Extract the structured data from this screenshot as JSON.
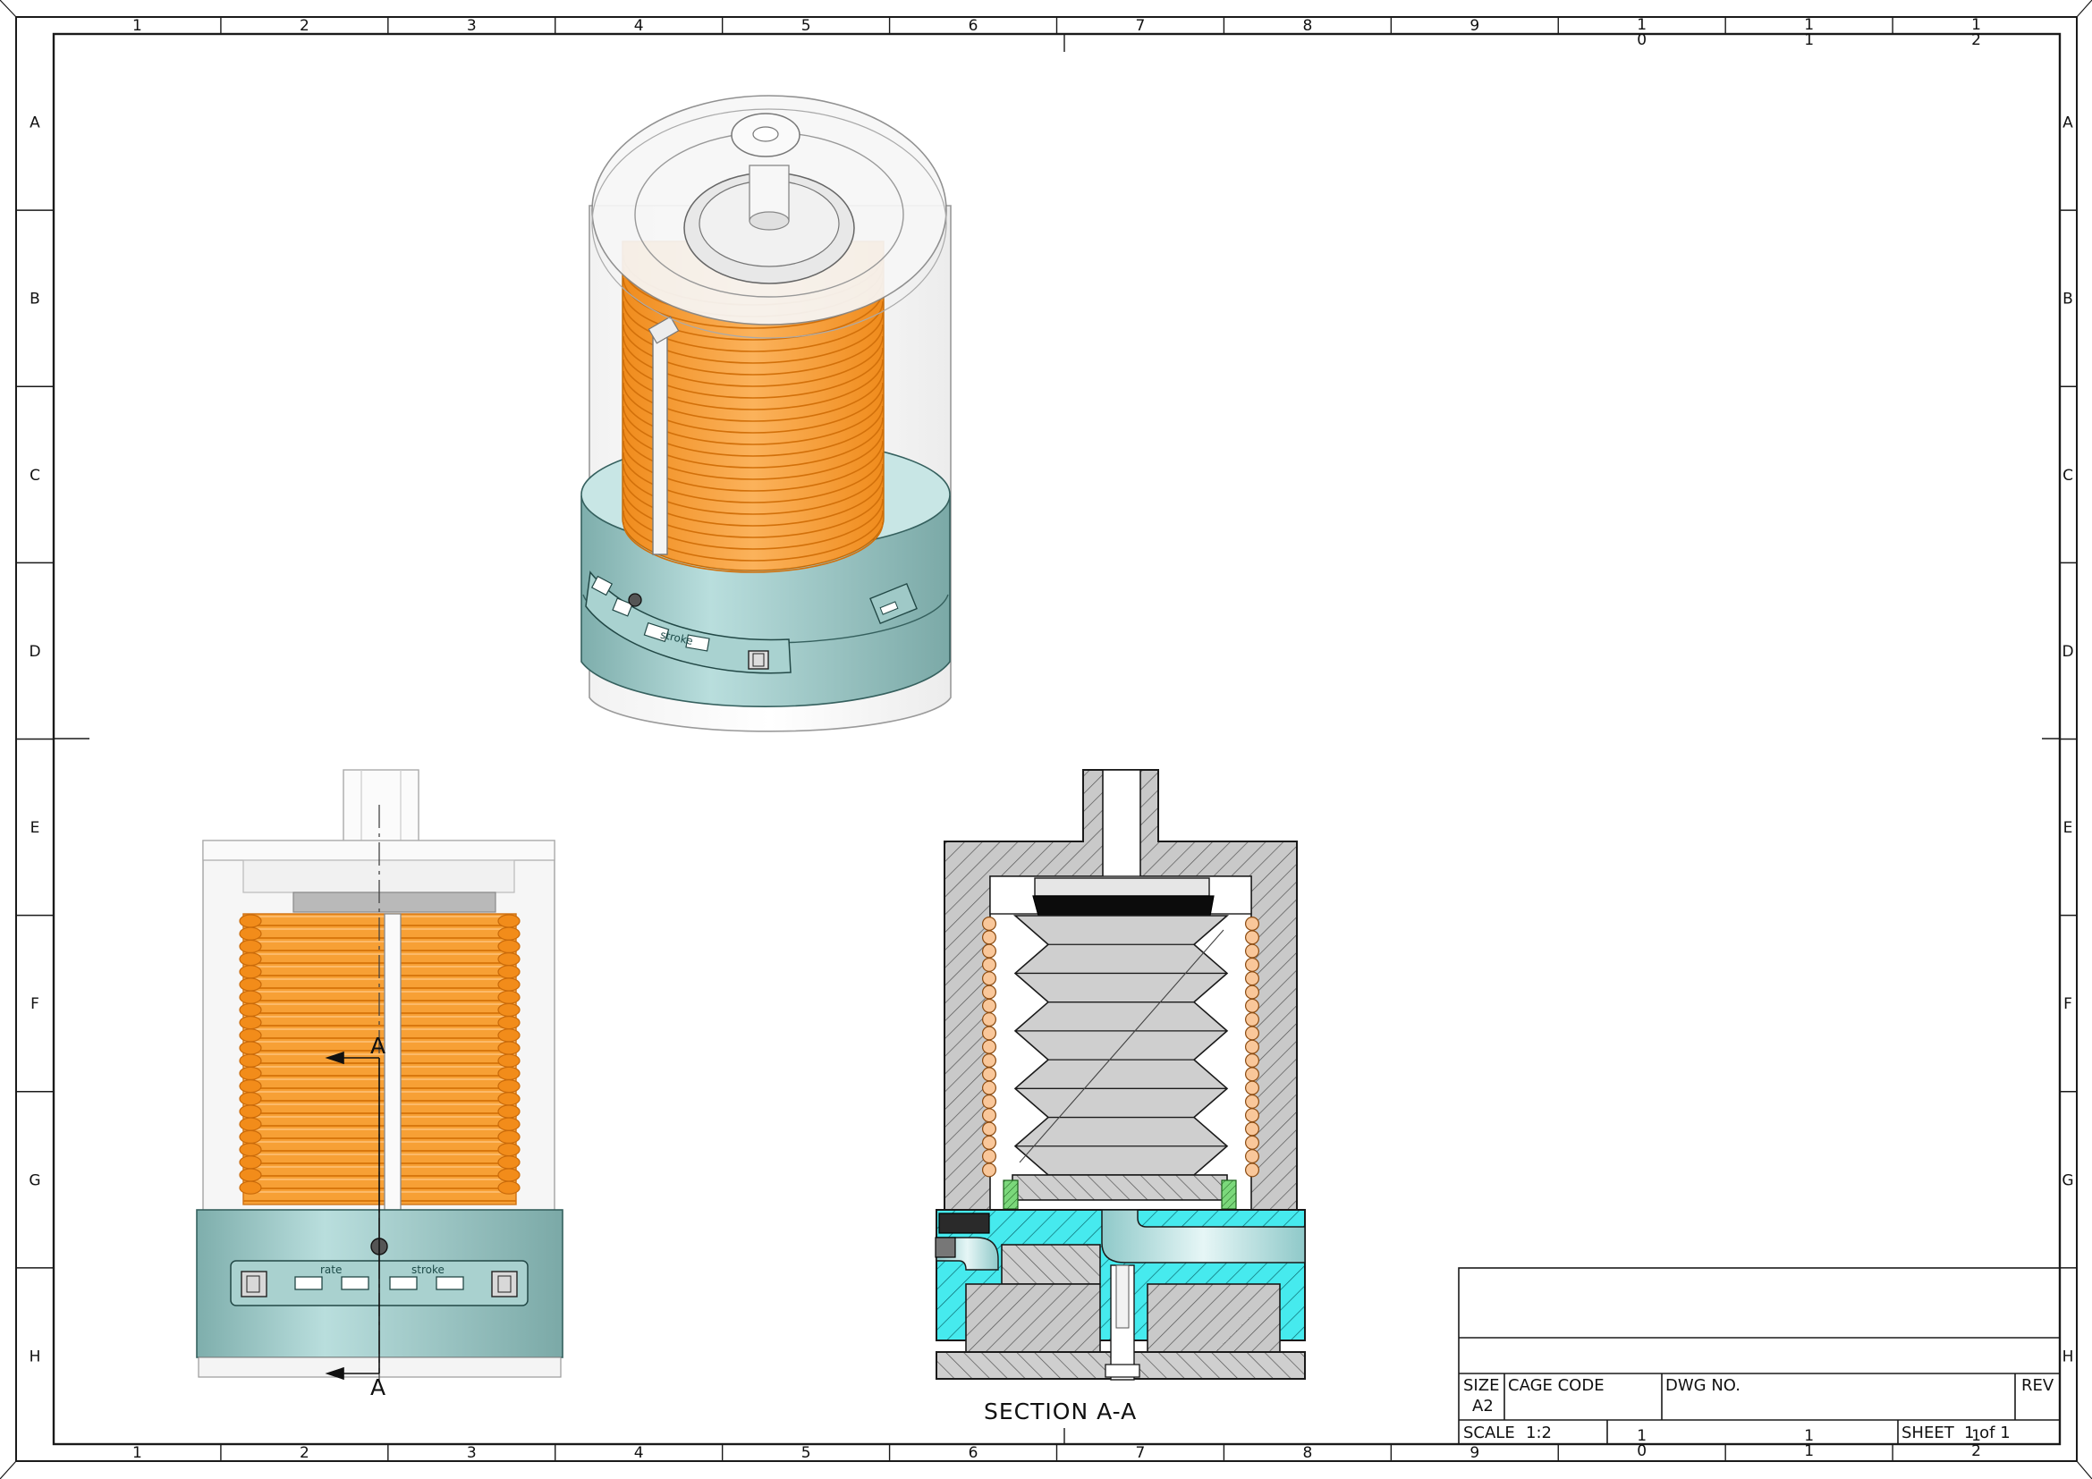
{
  "drawing": {
    "zones": {
      "columns": [
        "1",
        "2",
        "3",
        "4",
        "5",
        "6",
        "7",
        "8",
        "9",
        "1|0",
        "1|1",
        "1|2"
      ],
      "rows": [
        "A",
        "B",
        "C",
        "D",
        "E",
        "F",
        "G",
        "H"
      ]
    },
    "views": {
      "front_labels": {
        "rate": "rate",
        "stroke": "stroke"
      },
      "iso_labels": {
        "stroke": "stroke"
      },
      "section_marker": "A",
      "section_title": "SECTION A-A"
    },
    "title_block": {
      "size_label": "SIZE",
      "size_value": "A2",
      "cage_code_label": "CAGE CODE",
      "dwg_no_label": "DWG NO.",
      "rev_label": "REV",
      "scale_label": "SCALE",
      "scale_value": "1:2",
      "sheet_label": "SHEET",
      "sheet_value": "1 of 1"
    },
    "colors": {
      "line": "#1a1a1a",
      "coil": "#f7a035",
      "coil_dark": "#e07d10",
      "base": "#8fbdbb",
      "base_dark": "#6fa2a0",
      "section_fluid": "#3fe6ea",
      "section_solid": "#bdbdbd",
      "seal_green": "#6bd36b"
    }
  }
}
